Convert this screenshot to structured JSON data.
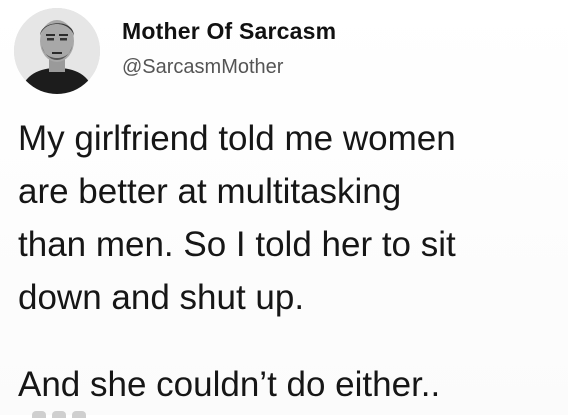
{
  "tweet": {
    "author": {
      "display_name": "Mother Of Sarcasm",
      "handle": "@SarcasmMother",
      "avatar": "profile-photo"
    },
    "text_lines": [
      "My girlfriend told me women",
      "are better at multitasking",
      "than men. So I told her to sit",
      "down and shut up."
    ],
    "punchline": "And she couldn’t do either.."
  }
}
